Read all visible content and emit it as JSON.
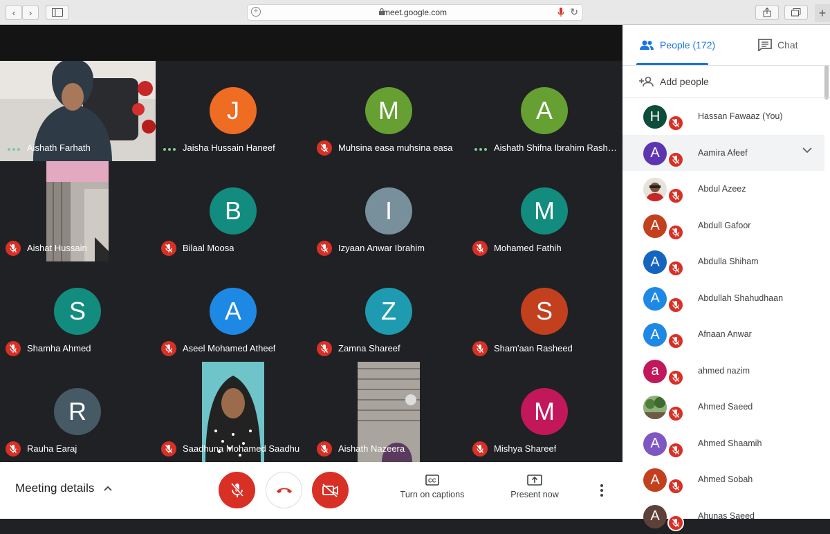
{
  "browser": {
    "url": "meet.google.com"
  },
  "side_panel": {
    "people_tab": "People (172)",
    "chat_tab": "Chat",
    "add_people": "Add people",
    "participants": [
      {
        "initial": "H",
        "name": "Hassan Fawaaz (You)",
        "color": "#0d4d3a"
      },
      {
        "initial": "A",
        "name": "Aamira Afeef",
        "color": "#5e35b1"
      },
      {
        "initial": "",
        "name": "Abdul Azeez",
        "color": "#d9d2c7"
      },
      {
        "initial": "A",
        "name": "Abdull Gafoor",
        "color": "#c2401e"
      },
      {
        "initial": "A",
        "name": "Abdulla Shiham",
        "color": "#1565c0"
      },
      {
        "initial": "A",
        "name": "Abdullah Shahudhaan",
        "color": "#1e88e5"
      },
      {
        "initial": "A",
        "name": "Afnaan Anwar",
        "color": "#1e88e5"
      },
      {
        "initial": "a",
        "name": "ahmed nazim",
        "color": "#c2185b"
      },
      {
        "initial": "",
        "name": "Ahmed Saeed",
        "color": "#6b8f5a"
      },
      {
        "initial": "A",
        "name": "Ahmed Shaamih",
        "color": "#7e57c2"
      },
      {
        "initial": "A",
        "name": "Ahmed Sobah",
        "color": "#c2401e"
      },
      {
        "initial": "A",
        "name": "Ahunas Saeed",
        "color": "#5d4037"
      }
    ]
  },
  "grid": {
    "tiles": [
      {
        "name": "Aishath Farhath",
        "type": "video",
        "status": "speaking"
      },
      {
        "name": "Jaisha Hussain Haneef",
        "initial": "J",
        "color": "#ef6c23",
        "status": "speaking"
      },
      {
        "name": "Muhsina easa muhsina easa",
        "initial": "M",
        "color": "#66a032",
        "status": "muted"
      },
      {
        "name": "Aishath Shifna Ibrahim Rashe...",
        "initial": "A",
        "color": "#66a032",
        "status": "speaking"
      },
      {
        "name": "Aishat Hussain",
        "type": "video",
        "status": "muted"
      },
      {
        "name": "Bilaal Moosa",
        "initial": "B",
        "color": "#128c7e",
        "status": "muted"
      },
      {
        "name": "Izyaan Anwar Ibrahim",
        "initial": "I",
        "color": "#78909c",
        "status": "muted"
      },
      {
        "name": "Mohamed Fathih",
        "initial": "M",
        "color": "#128c7e",
        "status": "muted"
      },
      {
        "name": "Shamha Ahmed",
        "initial": "S",
        "color": "#128c7e",
        "status": "muted"
      },
      {
        "name": "Aseel Mohamed Atheef",
        "initial": "A",
        "color": "#1e88e5",
        "status": "muted"
      },
      {
        "name": "Zamna Shareef",
        "initial": "Z",
        "color": "#1e9bb0",
        "status": "muted"
      },
      {
        "name": "Sham'aan Rasheed",
        "initial": "S",
        "color": "#c2401e",
        "status": "muted"
      },
      {
        "name": "Rauha Earaj",
        "initial": "R",
        "color": "#455a64",
        "status": "muted"
      },
      {
        "name": "Saadhuna Mohamed Saadhu",
        "type": "video",
        "status": "muted"
      },
      {
        "name": "Aishath Nazeera",
        "type": "video",
        "status": "muted"
      },
      {
        "name": "Mishya Shareef",
        "initial": "M",
        "color": "#c2185b",
        "status": "muted"
      }
    ]
  },
  "bottom_bar": {
    "meeting_details": "Meeting details",
    "captions": "Turn on captions",
    "present": "Present now"
  },
  "colors": {
    "accent": "#1a73e8",
    "mute_red": "#d93025",
    "tile_bg": "#202124"
  }
}
